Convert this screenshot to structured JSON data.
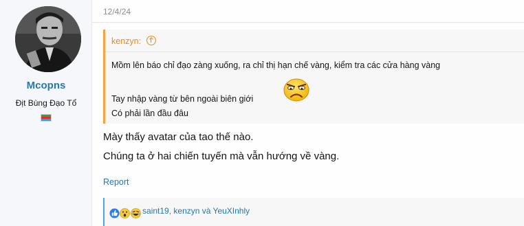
{
  "user": {
    "name": "Mcopns",
    "title": "Địt Bùng Đạo Tổ",
    "avatar_icon": "avatar-man-portrait",
    "flag_icon": "azerbaijan-flag-icon"
  },
  "post": {
    "date": "12/4/24",
    "quote": {
      "author": "kenzyn:",
      "lines": [
        "Mồm lên báo chỉ đạo zàng xuống, ra chỉ thị hạn chế vàng, kiểm tra các cửa hàng vàng",
        "Tay nhập vàng từ bên ngoài biên giới",
        "Có phải lần đầu đâu"
      ],
      "emoji": "frown-emoji"
    },
    "message": [
      "Mày thấy avatar của tao thế nào.",
      "Chúng ta ở hai chiến tuyến mà vẫn hướng về vàng."
    ],
    "report_label": "Report",
    "reactions": {
      "icons": [
        "like-icon",
        "wow-icon",
        "haha-icon"
      ],
      "text": "saint19, kenzyn và YeuXInhly"
    }
  },
  "colors": {
    "link": "#2577b1",
    "quote_accent": "#f9a13a",
    "reaction_accent": "#47a7eb",
    "sidebar_bg": "#f5f7fa"
  }
}
